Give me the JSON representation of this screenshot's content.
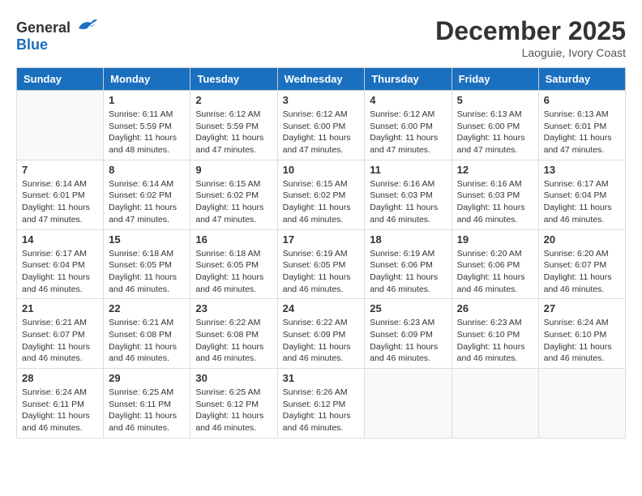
{
  "header": {
    "logo_general": "General",
    "logo_blue": "Blue",
    "month": "December 2025",
    "location": "Laoguie, Ivory Coast"
  },
  "days_of_week": [
    "Sunday",
    "Monday",
    "Tuesday",
    "Wednesday",
    "Thursday",
    "Friday",
    "Saturday"
  ],
  "weeks": [
    [
      {
        "day": "",
        "empty": true
      },
      {
        "day": "1",
        "sunrise": "6:11 AM",
        "sunset": "5:59 PM",
        "daylight": "11 hours and 48 minutes."
      },
      {
        "day": "2",
        "sunrise": "6:12 AM",
        "sunset": "5:59 PM",
        "daylight": "11 hours and 47 minutes."
      },
      {
        "day": "3",
        "sunrise": "6:12 AM",
        "sunset": "6:00 PM",
        "daylight": "11 hours and 47 minutes."
      },
      {
        "day": "4",
        "sunrise": "6:12 AM",
        "sunset": "6:00 PM",
        "daylight": "11 hours and 47 minutes."
      },
      {
        "day": "5",
        "sunrise": "6:13 AM",
        "sunset": "6:00 PM",
        "daylight": "11 hours and 47 minutes."
      },
      {
        "day": "6",
        "sunrise": "6:13 AM",
        "sunset": "6:01 PM",
        "daylight": "11 hours and 47 minutes."
      }
    ],
    [
      {
        "day": "7",
        "sunrise": "6:14 AM",
        "sunset": "6:01 PM",
        "daylight": "11 hours and 47 minutes."
      },
      {
        "day": "8",
        "sunrise": "6:14 AM",
        "sunset": "6:02 PM",
        "daylight": "11 hours and 47 minutes."
      },
      {
        "day": "9",
        "sunrise": "6:15 AM",
        "sunset": "6:02 PM",
        "daylight": "11 hours and 47 minutes."
      },
      {
        "day": "10",
        "sunrise": "6:15 AM",
        "sunset": "6:02 PM",
        "daylight": "11 hours and 46 minutes."
      },
      {
        "day": "11",
        "sunrise": "6:16 AM",
        "sunset": "6:03 PM",
        "daylight": "11 hours and 46 minutes."
      },
      {
        "day": "12",
        "sunrise": "6:16 AM",
        "sunset": "6:03 PM",
        "daylight": "11 hours and 46 minutes."
      },
      {
        "day": "13",
        "sunrise": "6:17 AM",
        "sunset": "6:04 PM",
        "daylight": "11 hours and 46 minutes."
      }
    ],
    [
      {
        "day": "14",
        "sunrise": "6:17 AM",
        "sunset": "6:04 PM",
        "daylight": "11 hours and 46 minutes."
      },
      {
        "day": "15",
        "sunrise": "6:18 AM",
        "sunset": "6:05 PM",
        "daylight": "11 hours and 46 minutes."
      },
      {
        "day": "16",
        "sunrise": "6:18 AM",
        "sunset": "6:05 PM",
        "daylight": "11 hours and 46 minutes."
      },
      {
        "day": "17",
        "sunrise": "6:19 AM",
        "sunset": "6:05 PM",
        "daylight": "11 hours and 46 minutes."
      },
      {
        "day": "18",
        "sunrise": "6:19 AM",
        "sunset": "6:06 PM",
        "daylight": "11 hours and 46 minutes."
      },
      {
        "day": "19",
        "sunrise": "6:20 AM",
        "sunset": "6:06 PM",
        "daylight": "11 hours and 46 minutes."
      },
      {
        "day": "20",
        "sunrise": "6:20 AM",
        "sunset": "6:07 PM",
        "daylight": "11 hours and 46 minutes."
      }
    ],
    [
      {
        "day": "21",
        "sunrise": "6:21 AM",
        "sunset": "6:07 PM",
        "daylight": "11 hours and 46 minutes."
      },
      {
        "day": "22",
        "sunrise": "6:21 AM",
        "sunset": "6:08 PM",
        "daylight": "11 hours and 46 minutes."
      },
      {
        "day": "23",
        "sunrise": "6:22 AM",
        "sunset": "6:08 PM",
        "daylight": "11 hours and 46 minutes."
      },
      {
        "day": "24",
        "sunrise": "6:22 AM",
        "sunset": "6:09 PM",
        "daylight": "11 hours and 46 minutes."
      },
      {
        "day": "25",
        "sunrise": "6:23 AM",
        "sunset": "6:09 PM",
        "daylight": "11 hours and 46 minutes."
      },
      {
        "day": "26",
        "sunrise": "6:23 AM",
        "sunset": "6:10 PM",
        "daylight": "11 hours and 46 minutes."
      },
      {
        "day": "27",
        "sunrise": "6:24 AM",
        "sunset": "6:10 PM",
        "daylight": "11 hours and 46 minutes."
      }
    ],
    [
      {
        "day": "28",
        "sunrise": "6:24 AM",
        "sunset": "6:11 PM",
        "daylight": "11 hours and 46 minutes."
      },
      {
        "day": "29",
        "sunrise": "6:25 AM",
        "sunset": "6:11 PM",
        "daylight": "11 hours and 46 minutes."
      },
      {
        "day": "30",
        "sunrise": "6:25 AM",
        "sunset": "6:12 PM",
        "daylight": "11 hours and 46 minutes."
      },
      {
        "day": "31",
        "sunrise": "6:26 AM",
        "sunset": "6:12 PM",
        "daylight": "11 hours and 46 minutes."
      },
      {
        "day": "",
        "empty": true
      },
      {
        "day": "",
        "empty": true
      },
      {
        "day": "",
        "empty": true
      }
    ]
  ]
}
